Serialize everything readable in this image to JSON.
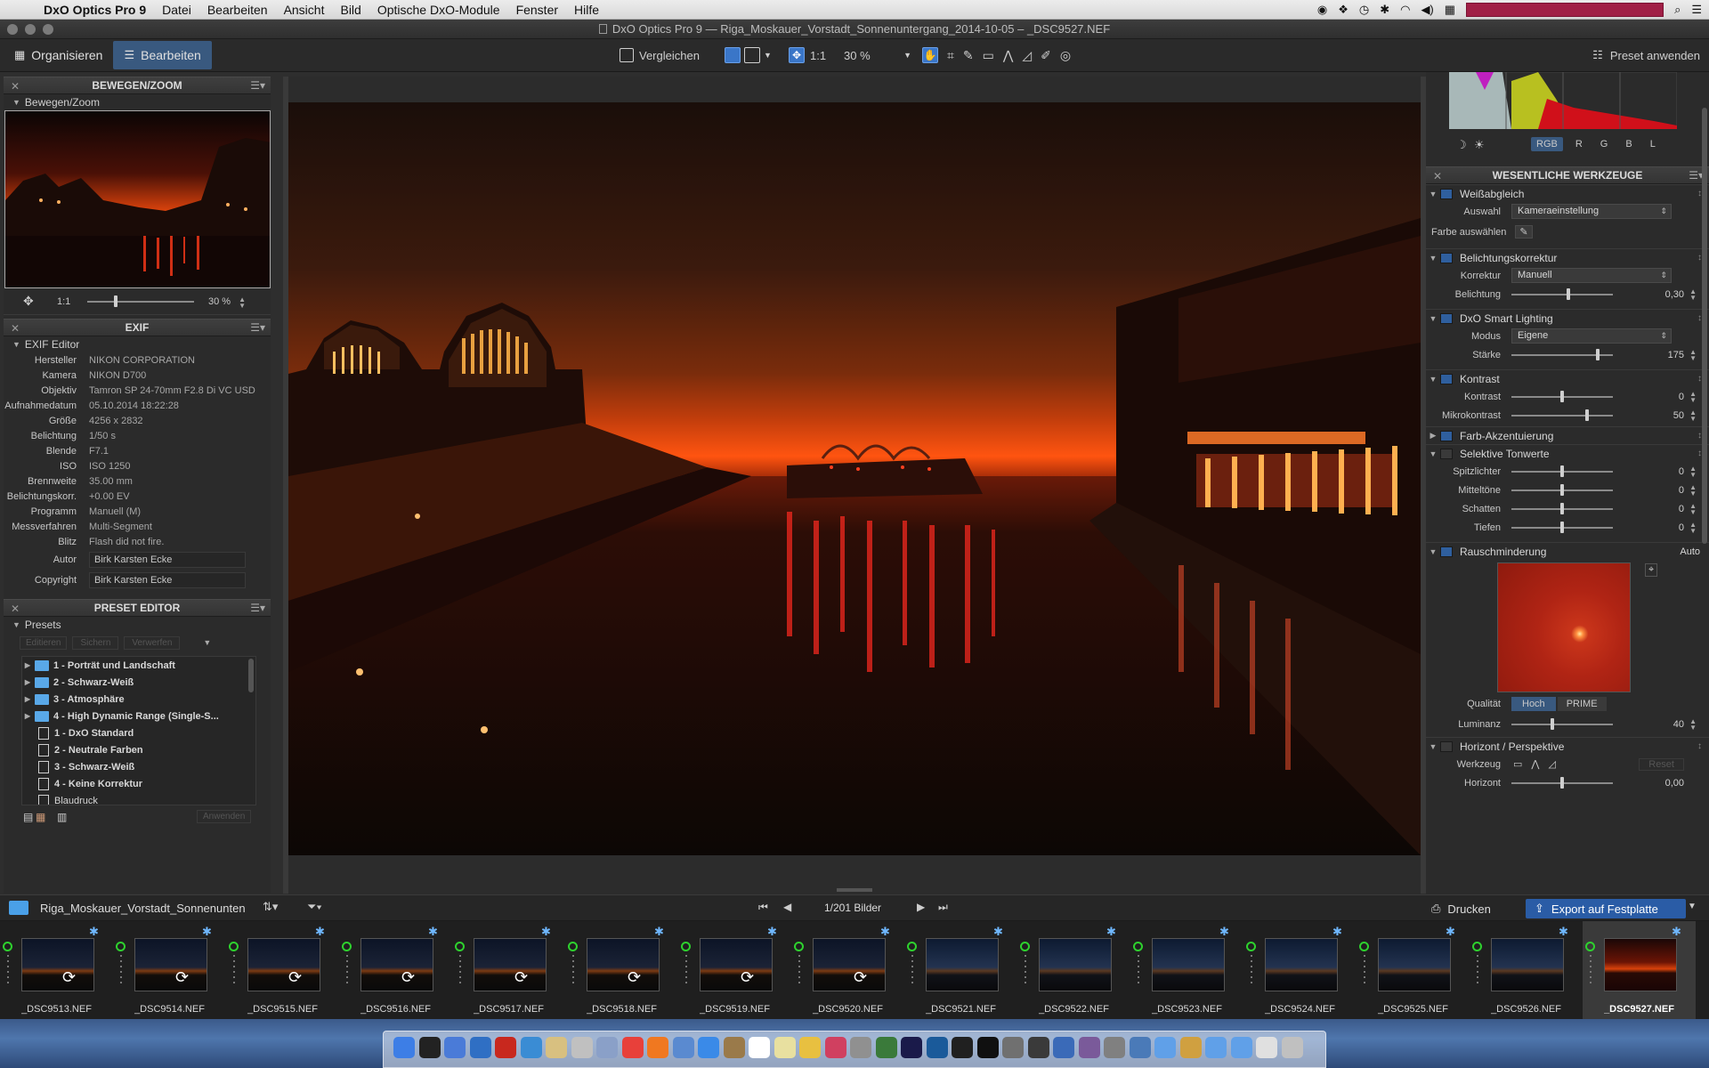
{
  "menubar": {
    "app": "DxO Optics Pro 9",
    "items": [
      "Datei",
      "Bearbeiten",
      "Ansicht",
      "Bild",
      "Optische DxO-Module",
      "Fenster",
      "Hilfe"
    ]
  },
  "window": {
    "title": "DxO Optics Pro 9 — Riga_Moskauer_Vorstadt_Sonnenuntergang_2014-10-05 – _DSC9527.NEF"
  },
  "toolbar": {
    "organize": "Organisieren",
    "edit": "Bearbeiten",
    "compare": "Vergleichen",
    "ratio": "1:1",
    "zoom": "30 %",
    "preset_apply": "Preset anwenden"
  },
  "move_zoom": {
    "title": "BEWEGEN/ZOOM",
    "sub": "Bewegen/Zoom",
    "ratio": "1:1",
    "zoom": "30 %"
  },
  "exif": {
    "title": "EXIF",
    "sub": "EXIF Editor",
    "rows": [
      {
        "k": "Hersteller",
        "v": "NIKON CORPORATION"
      },
      {
        "k": "Kamera",
        "v": "NIKON D700"
      },
      {
        "k": "Objektiv",
        "v": "Tamron SP 24-70mm F2.8 Di VC USD"
      },
      {
        "k": "Aufnahmedatum",
        "v": "05.10.2014 18:22:28"
      },
      {
        "k": "Größe",
        "v": "4256 x 2832"
      },
      {
        "k": "Belichtung",
        "v": "1/50 s"
      },
      {
        "k": "Blende",
        "v": "F7.1"
      },
      {
        "k": "ISO",
        "v": "ISO 1250"
      },
      {
        "k": "Brennweite",
        "v": "35.00 mm"
      },
      {
        "k": "Belichtungskorr.",
        "v": "+0.00 EV"
      },
      {
        "k": "Programm",
        "v": "Manuell (M)"
      },
      {
        "k": "Messverfahren",
        "v": "Multi-Segment"
      },
      {
        "k": "Blitz",
        "v": "Flash did not fire."
      }
    ],
    "author_k": "Autor",
    "author_v": "Birk Karsten Ecke",
    "copyright_k": "Copyright",
    "copyright_v": "Birk Karsten Ecke"
  },
  "preset_editor": {
    "title": "PRESET EDITOR",
    "sub": "Presets",
    "btn_edit": "Editieren",
    "btn_save": "Sichern",
    "btn_manage": "Verwerfen",
    "btn_apply": "Anwenden",
    "tree": [
      {
        "type": "folder",
        "label": "1 - Porträt und Landschaft"
      },
      {
        "type": "folder",
        "label": "2 - Schwarz-Weiß"
      },
      {
        "type": "folder",
        "label": "3 - Atmosphäre"
      },
      {
        "type": "folder",
        "label": "4 - High Dynamic Range (Single-S..."
      },
      {
        "type": "preset",
        "label": "1 - DxO Standard"
      },
      {
        "type": "preset",
        "label": "2 - Neutrale Farben"
      },
      {
        "type": "preset",
        "label": "3 - Schwarz-Weiß"
      },
      {
        "type": "preset",
        "label": "4 - Keine Korrektur"
      },
      {
        "type": "preset",
        "label": "Blaudruck"
      }
    ]
  },
  "histogram": {
    "channels": [
      "RGB",
      "R",
      "G",
      "B",
      "L"
    ]
  },
  "tools": {
    "title": "WESENTLICHE WERKZEUGE",
    "wb": {
      "title": "Weißabgleich",
      "sel_k": "Auswahl",
      "sel_v": "Kameraeinstellung",
      "pick": "Farbe auswählen"
    },
    "exposure": {
      "title": "Belichtungskorrektur",
      "mode_k": "Korrektur",
      "mode_v": "Manuell",
      "exp_k": "Belichtung",
      "exp_v": "0,30"
    },
    "smart": {
      "title": "DxO Smart Lighting",
      "mode_k": "Modus",
      "mode_v": "Eigene",
      "str_k": "Stärke",
      "str_v": "175"
    },
    "contrast": {
      "title": "Kontrast",
      "c_k": "Kontrast",
      "c_v": "0",
      "m_k": "Mikrokontrast",
      "m_v": "50"
    },
    "accent": {
      "title": "Farb-Akzentuierung"
    },
    "tones": {
      "title": "Selektive Tonwerte",
      "rows": [
        {
          "k": "Spitzlichter",
          "v": "0"
        },
        {
          "k": "Mitteltöne",
          "v": "0"
        },
        {
          "k": "Schatten",
          "v": "0"
        },
        {
          "k": "Tiefen",
          "v": "0"
        }
      ]
    },
    "noise": {
      "title": "Rauschminderung",
      "auto": "Auto",
      "q_k": "Qualität",
      "q_high": "Hoch",
      "q_prime": "PRIME",
      "lum_k": "Luminanz",
      "lum_v": "40"
    },
    "horizon": {
      "title": "Horizont / Perspektive",
      "tool_k": "Werkzeug",
      "reset": "Reset",
      "h_k": "Horizont",
      "h_v": "0,00"
    }
  },
  "filmbar": {
    "folder": "Riga_Moskauer_Vorstadt_Sonnenunten",
    "counter": "1/201 Bilder",
    "print": "Drucken",
    "export": "Export auf Festplatte"
  },
  "filmstrip": [
    "_DSC9513.NEF",
    "_DSC9514.NEF",
    "_DSC9515.NEF",
    "_DSC9516.NEF",
    "_DSC9517.NEF",
    "_DSC9518.NEF",
    "_DSC9519.NEF",
    "_DSC9520.NEF",
    "_DSC9521.NEF",
    "_DSC9522.NEF",
    "_DSC9523.NEF",
    "_DSC9524.NEF",
    "_DSC9525.NEF",
    "_DSC9526.NEF",
    "_DSC9527.NEF"
  ]
}
